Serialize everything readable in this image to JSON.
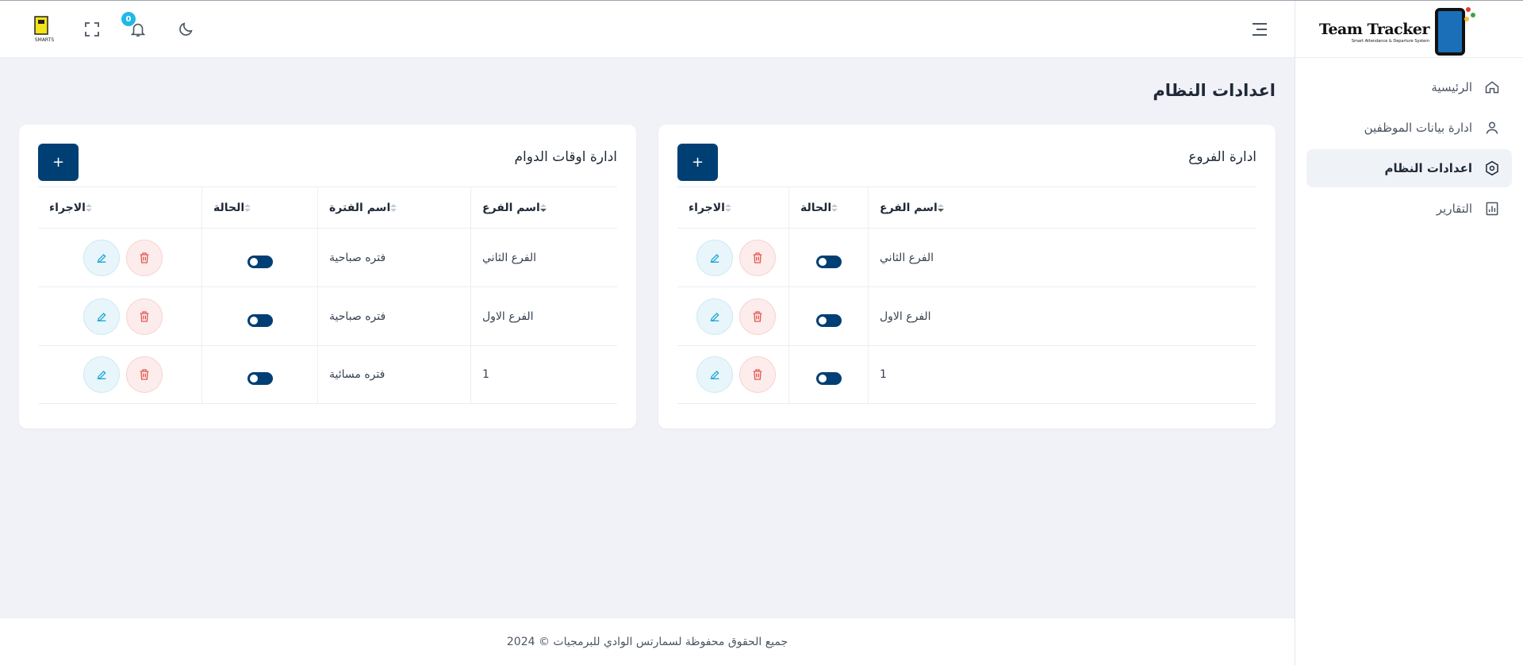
{
  "brand": {
    "name": "Team Tracker",
    "tagline": "Smart Attendance & Departure System",
    "colors": {
      "primary": "#003f74",
      "badge": "#22b8e6",
      "edit": "#22a9d4",
      "delete": "#e25a4f"
    }
  },
  "header": {
    "notifications_count": "0",
    "icons": [
      "menu-icon",
      "moon-icon",
      "bell-icon",
      "fullscreen-icon",
      "avatar"
    ]
  },
  "sidebar": {
    "items": [
      {
        "label": "الرئيسية",
        "icon": "home-icon",
        "active": false
      },
      {
        "label": "ادارة بيانات الموظفين",
        "icon": "user-icon",
        "active": false
      },
      {
        "label": "اعدادات النظام",
        "icon": "settings-icon",
        "active": true
      },
      {
        "label": "التقارير",
        "icon": "report-icon",
        "active": false
      }
    ]
  },
  "page": {
    "title": "اعدادات النظام"
  },
  "branches": {
    "title": "ادارة الفروع",
    "add_label": "+",
    "columns": [
      "اسم الفرع",
      "الحالة",
      "الاجراء"
    ],
    "rows": [
      {
        "name": "الفرع الثاني",
        "status": true
      },
      {
        "name": "الفرع الاول",
        "status": true
      },
      {
        "name": "1",
        "status": true
      }
    ]
  },
  "shifts": {
    "title": "ادارة اوقات الدوام",
    "add_label": "+",
    "columns": [
      "اسم الفرع",
      "اسم الفترة",
      "الحالة",
      "الاجراء"
    ],
    "rows": [
      {
        "branch": "الفرع الثاني",
        "period": "فتره صباحية",
        "status": true
      },
      {
        "branch": "الفرع الاول",
        "period": "فتره صباحية",
        "status": true
      },
      {
        "branch": "1",
        "period": "فتره مسائية",
        "status": true
      }
    ]
  },
  "footer": {
    "text": "جميع الحقوق محفوظة لسمارتس الوادي للبرمجيات © 2024"
  }
}
